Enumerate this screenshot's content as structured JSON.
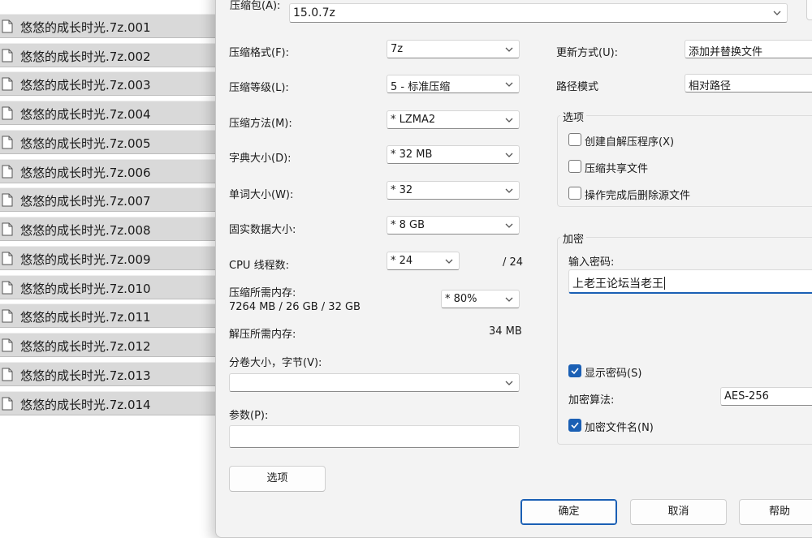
{
  "file_list": {
    "items": [
      "悠悠的成长时光.7z.001",
      "悠悠的成长时光.7z.002",
      "悠悠的成长时光.7z.003",
      "悠悠的成长时光.7z.004",
      "悠悠的成长时光.7z.005",
      "悠悠的成长时光.7z.006",
      "悠悠的成长时光.7z.007",
      "悠悠的成长时光.7z.008",
      "悠悠的成长时光.7z.009",
      "悠悠的成长时光.7z.010",
      "悠悠的成长时光.7z.011",
      "悠悠的成长时光.7z.012",
      "悠悠的成长时光.7z.013",
      "悠悠的成长时光.7z.014"
    ],
    "icon": "file-icon"
  },
  "dialog": {
    "archive_label": "压缩包(A):",
    "archive_value": "15.0.7z",
    "left": {
      "format_label": "压缩格式(F):",
      "format_value": "7z",
      "level_label": "压缩等级(L):",
      "level_value": "5 - 标准压缩",
      "method_label": "压缩方法(M):",
      "method_value": "* LZMA2",
      "dict_label": "字典大小(D):",
      "dict_value": "* 32 MB",
      "word_label": "单词大小(W):",
      "word_value": "* 32",
      "solid_label": "固实数据大小:",
      "solid_value": "* 8 GB",
      "threads_label": "CPU 线程数:",
      "threads_value": "* 24",
      "threads_max": "/ 24",
      "mem_comp_label": "压缩所需内存:",
      "mem_comp_detail": "7264 MB / 26 GB / 32 GB",
      "mem_comp_value": "* 80%",
      "mem_decomp_label": "解压所需内存:",
      "mem_decomp_value": "34 MB",
      "volume_label": "分卷大小，字节(V):",
      "volume_value": "",
      "params_label": "参数(P):",
      "params_value": "",
      "options_button": "选项"
    },
    "right": {
      "update_label": "更新方式(U):",
      "update_value": "添加并替换文件",
      "path_label": "路径模式",
      "path_value": "相对路径",
      "options_group": "选项",
      "opt_sfx": "创建自解压程序(X)",
      "opt_shared": "压缩共享文件",
      "opt_delete": "操作完成后删除源文件",
      "encrypt_group": "加密",
      "password_label": "输入密码:",
      "password_value": "上老王论坛当老王",
      "show_password": "显示密码(S)",
      "algo_label": "加密算法:",
      "algo_value": "AES-256",
      "encrypt_names": "加密文件名(N)"
    },
    "buttons": {
      "ok": "确定",
      "cancel": "取消",
      "help": "帮助"
    }
  },
  "colors": {
    "accent": "#1a5fb4",
    "dialog_bg": "#f3f3f3",
    "list_row_bg": "#d9d9d9"
  }
}
